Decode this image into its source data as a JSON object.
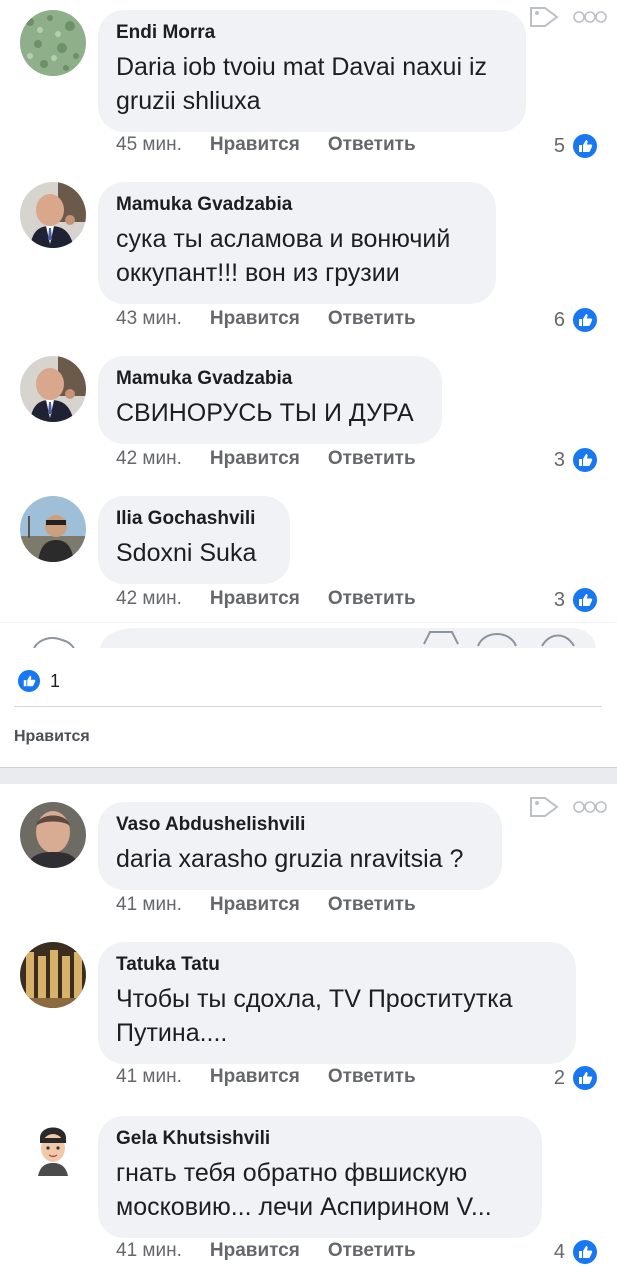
{
  "top_panel": {
    "comments": [
      {
        "author": "Endi Morra",
        "text": "Daria iob tvoiu mat Davai naxui iz gruzii shliuxa",
        "time": "45 мин.",
        "like": "Нравится",
        "reply": "Ответить",
        "reactions": "5"
      },
      {
        "author": "Mamuka Gvadzabia",
        "text": "сука ты асламова и вонючий оккупант!!! вон из грузии",
        "time": "43 мин.",
        "like": "Нравится",
        "reply": "Ответить",
        "reactions": "6"
      },
      {
        "author": "Mamuka Gvadzabia",
        "text": "СВИНОРУСЬ ТЫ И ДУРА",
        "time": "42 мин.",
        "like": "Нравится",
        "reply": "Ответить",
        "reactions": "3"
      },
      {
        "author": "Ilia Gochashvili",
        "text": "Sdoxni Suka",
        "time": "42 мин.",
        "like": "Нравится",
        "reply": "Ответить",
        "reactions": "3"
      }
    ]
  },
  "post_likes": {
    "count": "1",
    "like_button": "Нравится"
  },
  "bottom_panel": {
    "comments": [
      {
        "author": "Vaso Abdushelishvili",
        "text": "daria xarasho gruzia nravitsia ?",
        "time": "41 мин.",
        "like": "Нравится",
        "reply": "Ответить",
        "reactions": ""
      },
      {
        "author": "Tatuka Tatu",
        "text": "Чтобы ты сдохла,   TV Проститутка Путина....",
        "time": "41 мин.",
        "like": "Нравится",
        "reply": "Ответить",
        "reactions": "2"
      },
      {
        "author": "Gela Khutsishvili",
        "text": "гнать тебя обратно фвшискую московию... лечи Аспирином V...",
        "time": "41 мин.",
        "like": "Нравится",
        "reply": "Ответить",
        "reactions": "4"
      }
    ]
  },
  "icons": {
    "tag": "tag-icon",
    "more": "more-options-icon",
    "like": "thumbs-up-icon"
  },
  "colors": {
    "like_blue": "#1877f2",
    "bubble": "#f0f2f5",
    "meta": "#65676b"
  }
}
